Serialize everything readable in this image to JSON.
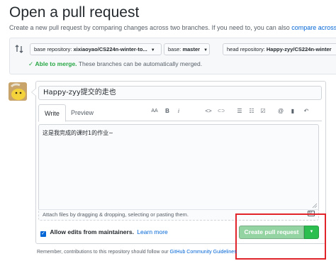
{
  "page": {
    "title": "Open a pull request",
    "subtitle_text": "Create a new pull request by comparing changes across two branches. If you need to, you can also",
    "subtitle_link": "compare across"
  },
  "compare": {
    "base_repo_label": "base repository:",
    "base_repo_value": "xixiaoyao/CS224n-winter-to...",
    "base_label": "base:",
    "base_value": "master",
    "head_repo_label": "head repository:",
    "head_repo_value": "Happy-zyy/CS224n-winter",
    "merge_status_bold": "Able to merge.",
    "merge_status_text": "These branches can be automatically merged."
  },
  "form": {
    "title_value": "Happy-zyy提交的走也",
    "tabs": [
      "Write",
      "Preview"
    ],
    "body_value": "这是我完成的课时1的作业~",
    "attach_text": "Attach files by dragging & dropping, selecting or pasting them.",
    "markdown_icon_text": "M↓",
    "allow_edits_label": "Allow edits from maintainers.",
    "learn_more": "Learn more",
    "create_button": "Create pull request"
  },
  "toolbar": {
    "heading": "AA",
    "bold": "B",
    "italic": "i",
    "code": "<>",
    "link": "⊂⊃",
    "ul": "☰",
    "ol": "☷",
    "tasklist": "☑",
    "mention": "@",
    "bookmark": "▮",
    "reply": "↶"
  },
  "footer": {
    "text": "Remember, contributions to this repository should follow our",
    "link": "GitHub Community Guidelines"
  },
  "colors": {
    "create_button_disabled": "#94d3a2",
    "dropdown_green": "#2cbe4e",
    "link_blue": "#0366d6",
    "success_green": "#28a745",
    "highlight_red": "#e0242a"
  }
}
